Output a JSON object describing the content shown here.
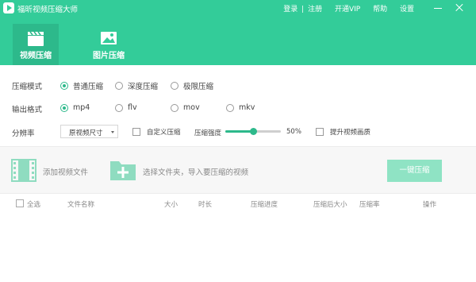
{
  "app": {
    "title": "福昕视频压缩大师"
  },
  "top_menu": {
    "login": "登录",
    "separator": "|",
    "register": "注册",
    "vip": "开通VIP",
    "help": "帮助",
    "settings": "设置"
  },
  "tabs": [
    {
      "label": "视频压缩",
      "icon": "clapperboard-icon",
      "active": true
    },
    {
      "label": "图片压缩",
      "icon": "image-icon",
      "active": false
    }
  ],
  "options": {
    "mode": {
      "label": "压缩模式",
      "choices": [
        "普通压缩",
        "深度压缩",
        "极限压缩"
      ],
      "selected": "普通压缩"
    },
    "format": {
      "label": "输出格式",
      "choices": [
        "mp4",
        "flv",
        "mov",
        "mkv"
      ],
      "selected": "mp4"
    },
    "resolution": {
      "label": "分辨率",
      "value": "原视频尺寸",
      "custom_label": "自定义压缩",
      "strength_label": "压缩强度",
      "strength_value": "50%",
      "strength": 0.5,
      "enhance_label": "提升视频画质"
    }
  },
  "toolbar": {
    "add_video": "添加视频文件",
    "select_folder": "选择文件夹，导入要压缩的视频",
    "one_click": "一键压缩"
  },
  "table": {
    "select_all": "全选",
    "columns": [
      "文件名称",
      "大小",
      "时长",
      "压缩进度",
      "压缩后大小",
      "压缩率",
      "操作"
    ]
  },
  "colors": {
    "brand": "#33cc99",
    "accent": "#2db98b",
    "button_disabled": "#8fe3c4"
  }
}
